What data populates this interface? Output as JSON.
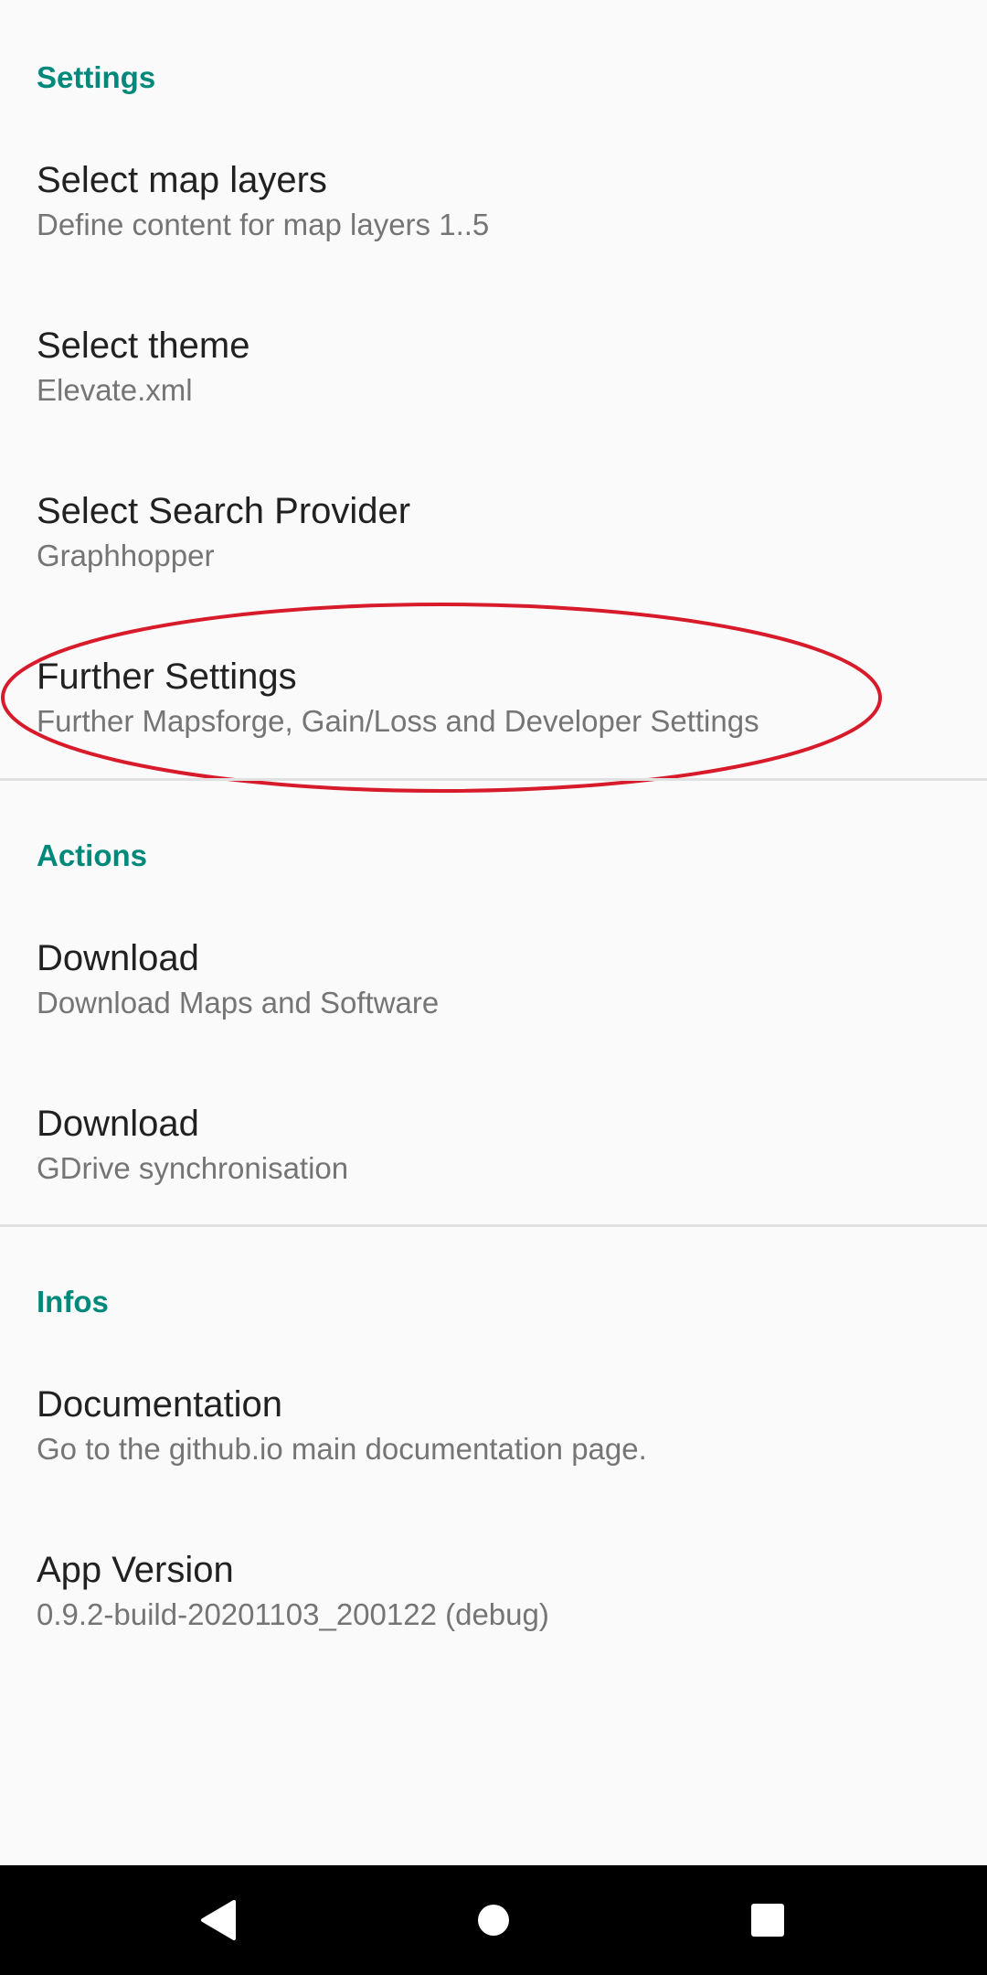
{
  "sections": {
    "settings": {
      "header": "Settings",
      "items": [
        {
          "title": "Select map layers",
          "summary": "Define content for map layers 1..5"
        },
        {
          "title": "Select theme",
          "summary": "Elevate.xml"
        },
        {
          "title": "Select Search Provider",
          "summary": "Graphhopper"
        },
        {
          "title": "Further Settings",
          "summary": "Further Mapsforge, Gain/Loss and Developer Settings"
        }
      ]
    },
    "actions": {
      "header": "Actions",
      "items": [
        {
          "title": "Download",
          "summary": "Download Maps and Software"
        },
        {
          "title": "Download",
          "summary": "GDrive synchronisation"
        }
      ]
    },
    "infos": {
      "header": "Infos",
      "items": [
        {
          "title": "Documentation",
          "summary": "Go to the github.io main documentation page."
        },
        {
          "title": "App Version",
          "summary": "0.9.2-build-20201103_200122 (debug)"
        }
      ]
    }
  },
  "colors": {
    "accent": "#00897b",
    "annotation": "#d81b2a",
    "title_text": "#212121",
    "summary_text": "#757575",
    "divider": "#e0e0e0",
    "nav_icon": "#ffffff"
  },
  "navigation_bar": {
    "buttons": [
      "back-icon",
      "home-icon",
      "recents-icon"
    ]
  }
}
